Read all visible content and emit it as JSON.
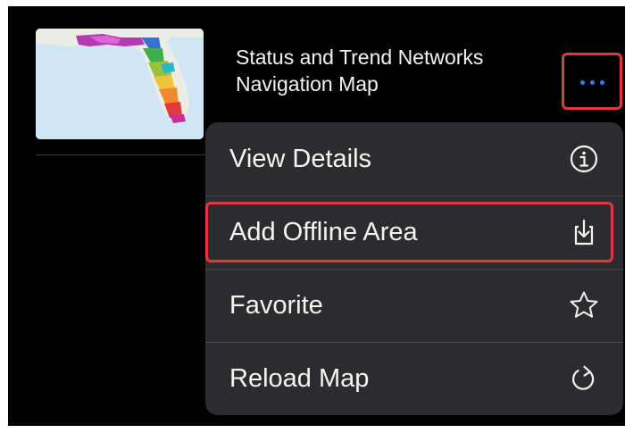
{
  "item": {
    "title_line1": "Status and Trend Networks",
    "title_line2": "Navigation Map"
  },
  "menu": {
    "items": [
      {
        "label": "View Details",
        "icon": "info-icon"
      },
      {
        "label": "Add Offline Area",
        "icon": "download-icon"
      },
      {
        "label": "Favorite",
        "icon": "star-icon"
      },
      {
        "label": "Reload Map",
        "icon": "reload-icon"
      }
    ]
  },
  "colors": {
    "accent": "#2f7df6",
    "highlight": "#e0393b",
    "menu_bg": "#2c2c2e",
    "screen_bg": "#000000"
  }
}
